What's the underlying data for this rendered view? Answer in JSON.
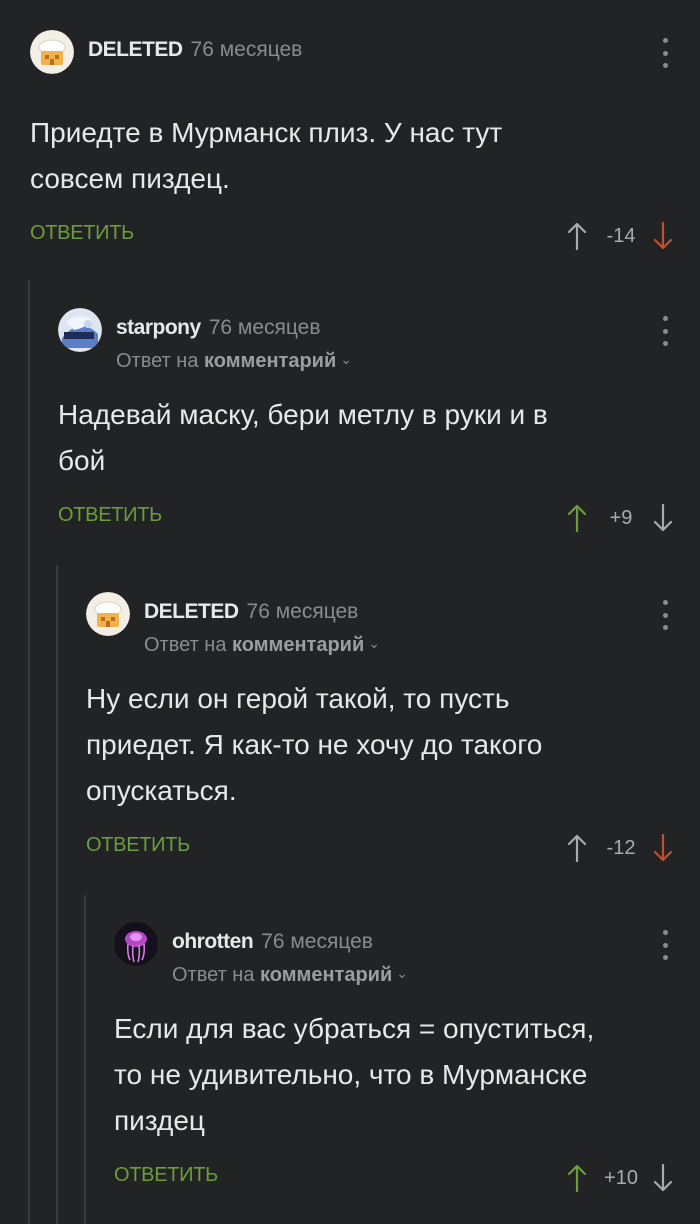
{
  "comments": [
    {
      "author": "DELETED",
      "time": "76 месяцев",
      "reply_prefix": "",
      "reply_target": "",
      "text": "Приедте в Мурманск плиз. У нас тут\nсовсем пиздец.",
      "reply_label": "ОТВЕТИТЬ",
      "rating": "-14",
      "vote": "down",
      "avatar": "deleted-avatar"
    },
    {
      "author": "starpony",
      "time": "76 месяцев",
      "reply_prefix": "Ответ на",
      "reply_target": "комментарий",
      "text": "Надевай маску, бери метлу в руки и в\nбой",
      "reply_label": "ОТВЕТИТЬ",
      "rating": "+9",
      "vote": "up",
      "avatar": "starpony-avatar"
    },
    {
      "author": "DELETED",
      "time": "76 месяцев",
      "reply_prefix": "Ответ на",
      "reply_target": "комментарий",
      "text": "Ну если он герой такой, то пусть\nприедет. Я как-то не хочу до такого\nопускаться.",
      "reply_label": "ОТВЕТИТЬ",
      "rating": "-12",
      "vote": "down",
      "avatar": "deleted-avatar"
    },
    {
      "author": "ohrotten",
      "time": "76 месяцев",
      "reply_prefix": "Ответ на",
      "reply_target": "комментарий",
      "text": "Если для вас убраться = опуститься,\nто не удивительно, что в Мурманске\nпиздец",
      "reply_label": "ОТВЕТИТЬ",
      "rating": "+10",
      "vote": "up",
      "avatar": "jellyfish-avatar"
    }
  ],
  "colors": {
    "background": "#222324",
    "reply_button": "#6b9d3c",
    "upvote_active": "#6b9d3c",
    "downvote_active": "#c2502e",
    "vote_neutral": "#a9aaad",
    "muted_text": "#8a8b8d"
  }
}
